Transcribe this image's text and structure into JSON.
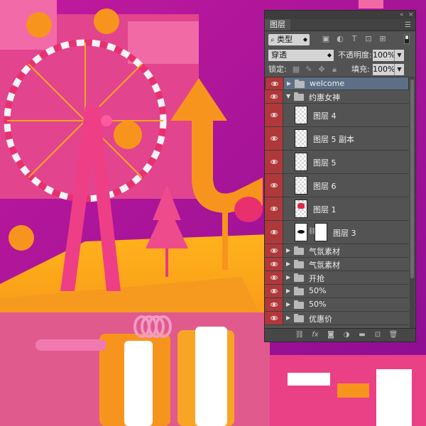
{
  "panel": {
    "tab": "图层",
    "filter_kind": "类型",
    "blend_mode": "穿透",
    "opacity_label": "不透明度:",
    "opacity_value": "100%",
    "lock_label": "锁定:",
    "fill_label": "填充:",
    "fill_value": "100%"
  },
  "layers": [
    {
      "name": "welcome",
      "kind": "group",
      "collapsed": true,
      "selected": true
    },
    {
      "name": "约惠女神",
      "kind": "group",
      "collapsed": false
    },
    {
      "name": "图层 4",
      "kind": "layer"
    },
    {
      "name": "图层 5 副本",
      "kind": "layer"
    },
    {
      "name": "图层 5",
      "kind": "layer"
    },
    {
      "name": "图层 6",
      "kind": "layer"
    },
    {
      "name": "图层 1",
      "kind": "layer"
    },
    {
      "name": "图层 3",
      "kind": "layer-mask"
    },
    {
      "name": "气氛素材",
      "kind": "group",
      "collapsed": true
    },
    {
      "name": "气氛素材",
      "kind": "group",
      "collapsed": true
    },
    {
      "name": "开抢",
      "kind": "group",
      "collapsed": true
    },
    {
      "name": "50%",
      "kind": "group",
      "collapsed": true
    },
    {
      "name": "50%",
      "kind": "group",
      "collapsed": true
    },
    {
      "name": "优惠价",
      "kind": "group",
      "collapsed": true
    }
  ],
  "colors": {
    "eye_cell": "#b0383a",
    "selected_row": "#5d6f87",
    "panel_bg": "#535353",
    "scene_purple": "#a3129b",
    "scene_pink": "#e83c8a",
    "scene_orange": "#f6941d"
  }
}
